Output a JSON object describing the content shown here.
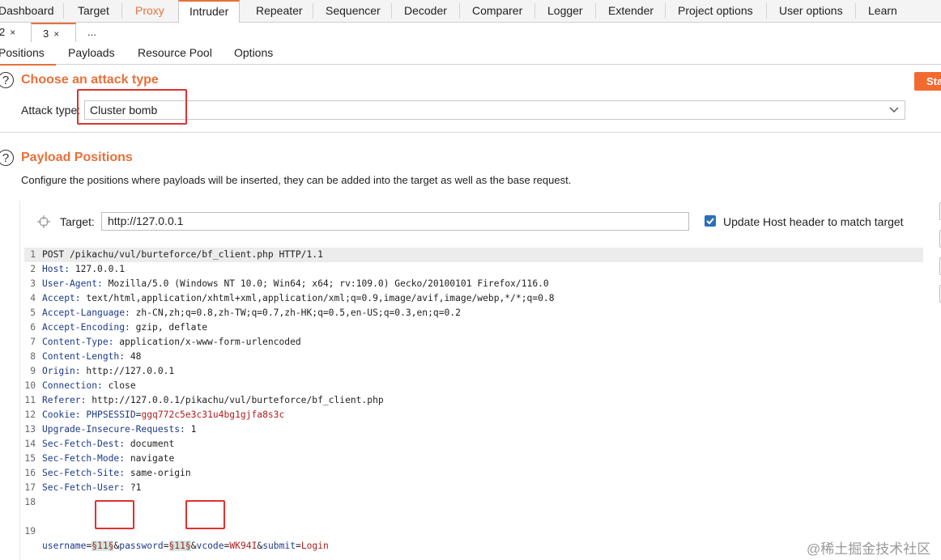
{
  "top_nav": [
    "Dashboard",
    "Target",
    "Proxy",
    "Intruder",
    "Repeater",
    "Sequencer",
    "Decoder",
    "Comparer",
    "Logger",
    "Extender",
    "Project options",
    "User options",
    "Learn"
  ],
  "sub_tabs": [
    {
      "label": "2",
      "close": "×"
    },
    {
      "label": "3",
      "close": "×"
    },
    {
      "label": "...",
      "close": ""
    }
  ],
  "panel_tabs": [
    "Positions",
    "Payloads",
    "Resource Pool",
    "Options"
  ],
  "attack": {
    "help": "?",
    "title": "Choose an attack type",
    "label": "Attack type:",
    "value": "Cluster bomb",
    "start_label": "Sta"
  },
  "positions": {
    "help": "?",
    "title": "Payload Positions",
    "description": "Configure the positions where payloads will be inserted, they can be added into the target as well as the base request.",
    "target_label": "Target:",
    "target_value": "http://127.0.0.1",
    "update_host_label": "Update Host header to match target",
    "update_host_checked": true
  },
  "request_lines": [
    {
      "n": "1",
      "k": "",
      "v": "POST /pikachu/vul/burteforce/bf_client.php HTTP/1.1"
    },
    {
      "n": "2",
      "k": "Host:",
      "v": " 127.0.0.1"
    },
    {
      "n": "3",
      "k": "User-Agent:",
      "v": " Mozilla/5.0 (Windows NT 10.0; Win64; x64; rv:109.0) Gecko/20100101 Firefox/116.0"
    },
    {
      "n": "4",
      "k": "Accept:",
      "v": " text/html,application/xhtml+xml,application/xml;q=0.9,image/avif,image/webp,*/*;q=0.8"
    },
    {
      "n": "5",
      "k": "Accept-Language:",
      "v": " zh-CN,zh;q=0.8,zh-TW;q=0.7,zh-HK;q=0.5,en-US;q=0.3,en;q=0.2"
    },
    {
      "n": "6",
      "k": "Accept-Encoding:",
      "v": " gzip, deflate"
    },
    {
      "n": "7",
      "k": "Content-Type:",
      "v": " application/x-www-form-urlencoded"
    },
    {
      "n": "8",
      "k": "Content-Length:",
      "v": " 48"
    },
    {
      "n": "9",
      "k": "Origin:",
      "v": " http://127.0.0.1"
    },
    {
      "n": "10",
      "k": "Connection:",
      "v": " close"
    },
    {
      "n": "11",
      "k": "Referer:",
      "v": " http://127.0.0.1/pikachu/vul/burteforce/bf_client.php"
    },
    {
      "n": "12",
      "k": "Cookie:",
      "v": " "
    },
    {
      "n": "13",
      "k": "Upgrade-Insecure-Requests:",
      "v": " 1"
    },
    {
      "n": "14",
      "k": "Sec-Fetch-Dest:",
      "v": " document"
    },
    {
      "n": "15",
      "k": "Sec-Fetch-Mode:",
      "v": " navigate"
    },
    {
      "n": "16",
      "k": "Sec-Fetch-Site:",
      "v": " same-origin"
    },
    {
      "n": "17",
      "k": "Sec-Fetch-User:",
      "v": " ?1"
    },
    {
      "n": "18",
      "k": "",
      "v": ""
    }
  ],
  "cookie": {
    "name": "PHPSESSID",
    "eq": "=",
    "value": "ggq772c5e3c31u4bg1gjfa8s3c"
  },
  "body_line": {
    "n": "19",
    "p1_name": "username",
    "eq1": "=",
    "p1_value": "§11§",
    "amp1": "&",
    "p2_name": "password",
    "eq2": "=",
    "p2_value": "§11§",
    "amp2": "&",
    "p3_name": "vcode",
    "eq3": "=",
    "p3_value": "WK94I",
    "amp3": "&",
    "p4_name": "submit",
    "eq4": "=",
    "p4_value": "Login"
  },
  "watermark": "@稀土掘金技术社区",
  "colors": {
    "accent": "#e8703a",
    "start_button": "#f26a30",
    "highlight_box": "#e03030",
    "payload_marker_bg": "#cfe8e2"
  }
}
